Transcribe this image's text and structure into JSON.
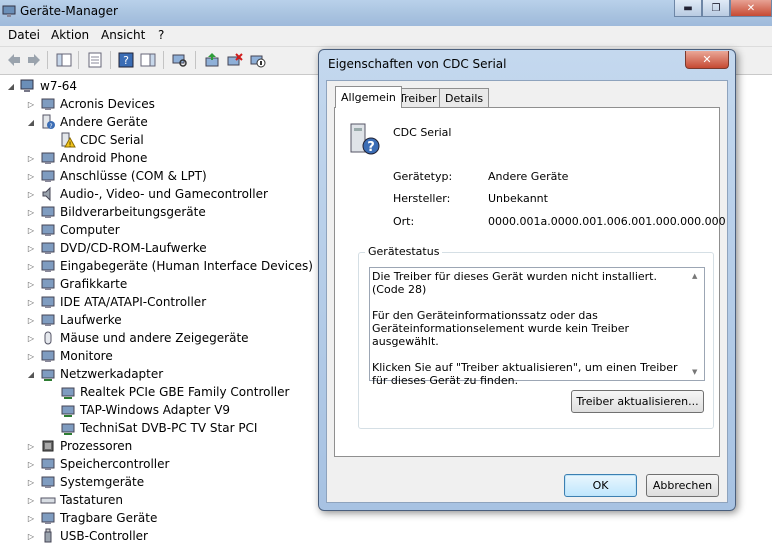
{
  "window": {
    "title": "Geräte-Manager",
    "min_glyph": "▬",
    "max_glyph": "❐",
    "close_glyph": "✕"
  },
  "menu": [
    "Datei",
    "Aktion",
    "Ansicht",
    "?"
  ],
  "tree": {
    "root": "w7-64",
    "items": [
      {
        "label": "Acronis Devices",
        "icon": "device-chip-icon"
      },
      {
        "label": "Andere Geräte",
        "icon": "unknown-device-icon"
      },
      {
        "label": "CDC Serial",
        "icon": "warning-device-icon"
      },
      {
        "label": "Android Phone",
        "icon": "phone-icon"
      },
      {
        "label": "Anschlüsse (COM & LPT)",
        "icon": "port-icon"
      },
      {
        "label": "Audio-, Video- und Gamecontroller",
        "icon": "speaker-icon"
      },
      {
        "label": "Bildverarbeitungsgeräte",
        "icon": "camera-icon"
      },
      {
        "label": "Computer",
        "icon": "computer-icon"
      },
      {
        "label": "DVD/CD-ROM-Laufwerke",
        "icon": "disc-drive-icon"
      },
      {
        "label": "Eingabegeräte (Human Interface Devices)",
        "icon": "hid-icon"
      },
      {
        "label": "Grafikkarte",
        "icon": "display-adapter-icon"
      },
      {
        "label": "IDE ATA/ATAPI-Controller",
        "icon": "ide-controller-icon"
      },
      {
        "label": "Laufwerke",
        "icon": "disk-drive-icon"
      },
      {
        "label": "Mäuse und andere Zeigegeräte",
        "icon": "mouse-icon"
      },
      {
        "label": "Monitore",
        "icon": "monitor-icon"
      },
      {
        "label": "Netzwerkadapter",
        "icon": "network-adapter-icon"
      },
      {
        "label": "Realtek PCIe GBE Family Controller",
        "icon": "network-adapter-icon"
      },
      {
        "label": "TAP-Windows Adapter V9",
        "icon": "network-adapter-icon"
      },
      {
        "label": "TechniSat DVB-PC TV Star PCI",
        "icon": "network-adapter-icon"
      },
      {
        "label": "Prozessoren",
        "icon": "processor-icon"
      },
      {
        "label": "Speichercontroller",
        "icon": "storage-controller-icon"
      },
      {
        "label": "Systemgeräte",
        "icon": "system-device-icon"
      },
      {
        "label": "Tastaturen",
        "icon": "keyboard-icon"
      },
      {
        "label": "Tragbare Geräte",
        "icon": "portable-device-icon"
      },
      {
        "label": "USB-Controller",
        "icon": "usb-icon"
      }
    ]
  },
  "dialog": {
    "title": "Eigenschaften von CDC Serial",
    "close_glyph": "✕",
    "tabs": [
      "Allgemein",
      "Treiber",
      "Details"
    ],
    "device_name": "CDC Serial",
    "props": [
      {
        "label": "Gerätetyp:",
        "value": "Andere Geräte"
      },
      {
        "label": "Hersteller:",
        "value": "Unbekannt"
      },
      {
        "label": "Ort:",
        "value": "0000.001a.0000.001.006.001.000.000.000"
      }
    ],
    "status_title": "Gerätestatus",
    "status_lines": [
      "Die Treiber für dieses Gerät wurden nicht installiert. (Code 28)",
      "Für den Geräteinformationssatz oder das Geräteinformationselement wurde kein Treiber ausgewählt.",
      "Klicken Sie auf \"Treiber aktualisieren\", um einen Treiber für dieses Gerät zu finden."
    ],
    "update_button": "Treiber aktualisieren...",
    "ok_button": "OK",
    "cancel_button": "Abbrechen"
  }
}
